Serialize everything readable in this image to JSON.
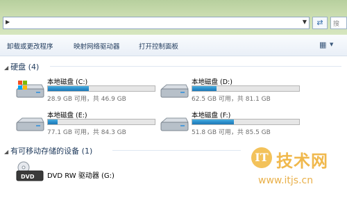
{
  "address": {
    "value": "",
    "search_placeholder": "搜"
  },
  "toolbar": {
    "items": [
      "卸载或更改程序",
      "映射网络驱动器",
      "打开控制面板"
    ]
  },
  "hard_disks": {
    "header": "硬盘 (4)",
    "drives": [
      {
        "name": "本地磁盘 (C:)",
        "free": "28.9 GB 可用，共 46.9 GB",
        "used_fraction": 0.38,
        "icon": "windows-drive-icon"
      },
      {
        "name": "本地磁盘 (D:)",
        "free": "62.5 GB 可用，共 81.1 GB",
        "used_fraction": 0.23,
        "icon": "hard-drive-icon"
      },
      {
        "name": "本地磁盘 (E:)",
        "free": "77.1 GB 可用，共 84.3 GB",
        "used_fraction": 0.09,
        "icon": "hard-drive-icon"
      },
      {
        "name": "本地磁盘 (F:)",
        "free": "51.8 GB 可用，共 85.5 GB",
        "used_fraction": 0.39,
        "icon": "hard-drive-icon"
      }
    ]
  },
  "removable": {
    "header": "有可移动存储的设备 (1)",
    "devices": [
      {
        "name": "DVD RW 驱动器 (G:)",
        "icon": "dvd-drive-icon"
      }
    ]
  },
  "watermark": {
    "logo": "IT",
    "text": "技术网",
    "url": "www.itjs.cn"
  },
  "colors": {
    "bar_fill": "#2a8cc9",
    "chrome": "#c9dcae",
    "watermark": "#f0b84c"
  }
}
